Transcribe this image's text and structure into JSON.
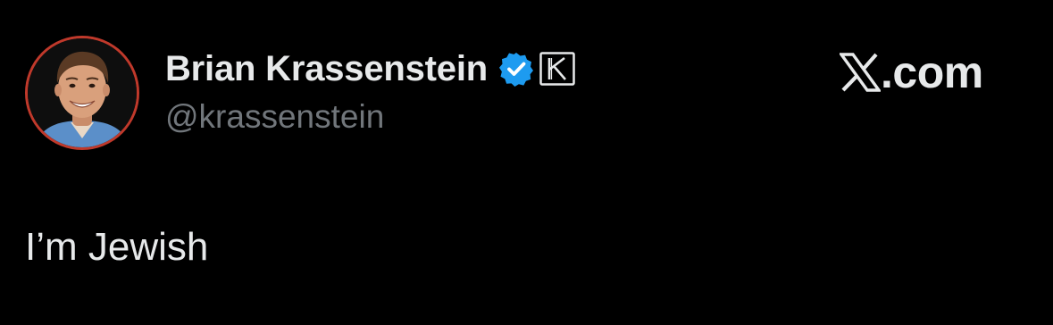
{
  "author": {
    "display_name": "Brian Krassenstein",
    "handle": "@krassenstein",
    "verified_icon": "verified-badge-icon",
    "affiliate_icon": "affiliate-k-badge-icon",
    "avatar_ring_color": "#c0392b",
    "verified_color": "#1d9bf0"
  },
  "brand": {
    "logo_icon": "x-logo-icon",
    "text": ".com"
  },
  "tweet": {
    "text": "I’m Jewish"
  },
  "colors": {
    "background": "#000000",
    "primary_text": "#e7e9ea",
    "secondary_text": "#71767b"
  }
}
